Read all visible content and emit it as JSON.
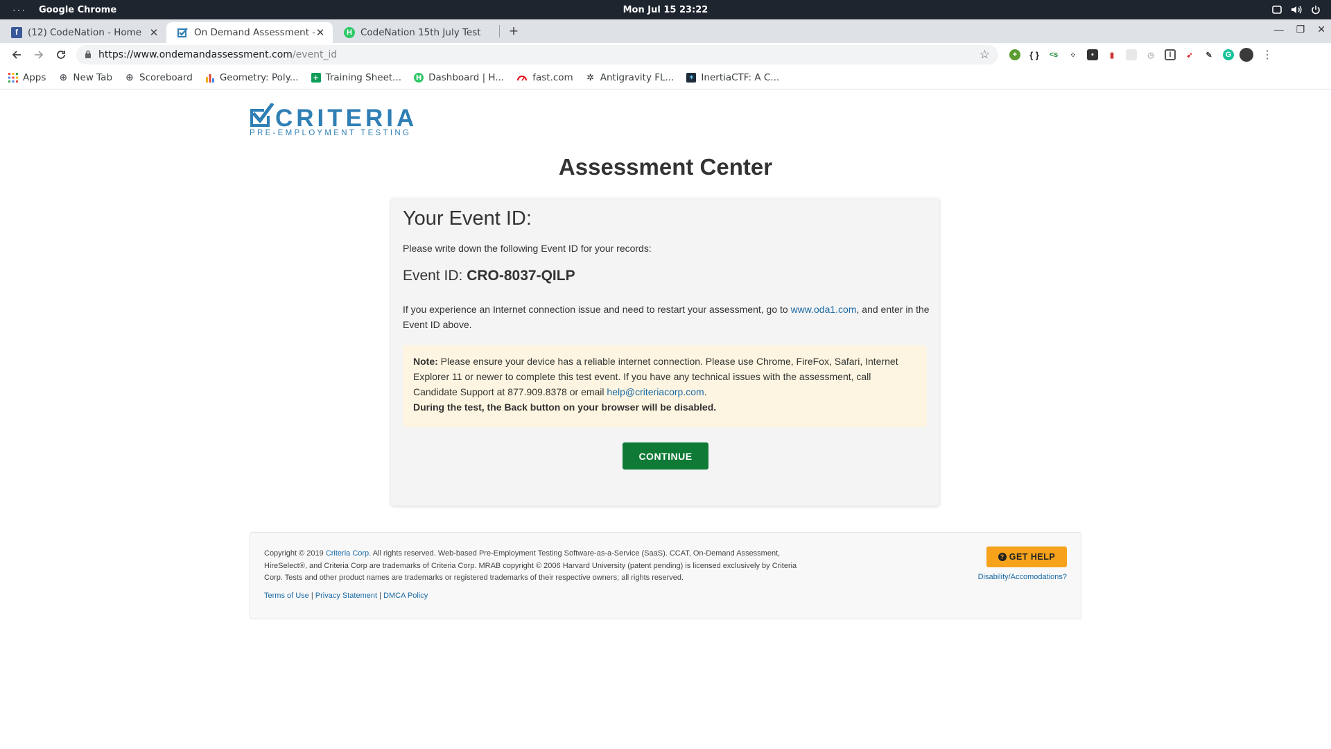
{
  "os_bar": {
    "menu": "···",
    "app_name": "Google Chrome",
    "clock": "Mon Jul 15  23:22"
  },
  "tabs": [
    {
      "title": "(12) CodeNation - Home",
      "favicon_color": "#3b5998",
      "favicon_letter": "f"
    },
    {
      "title": "On Demand Assessment -",
      "favicon_color": "#2f7fb5",
      "favicon_letter": "✓"
    },
    {
      "title": "CodeNation 15th July Test",
      "favicon_color": "#2ec866",
      "favicon_letter": "H"
    }
  ],
  "new_tab_symbol": "+",
  "toolbar": {
    "url_host": "https://www.ondemandassessment.com",
    "url_path": "/event_id"
  },
  "bookmarks": [
    {
      "label": "Apps",
      "icon": "apps-grid-icon"
    },
    {
      "label": "New Tab",
      "icon": "globe-icon"
    },
    {
      "label": "Scoreboard",
      "icon": "globe-icon"
    },
    {
      "label": "Geometry: Poly...",
      "icon": "bar-chart-icon"
    },
    {
      "label": "Training Sheet...",
      "icon": "sheets-icon"
    },
    {
      "label": "Dashboard | H...",
      "icon": "hackerrank-icon"
    },
    {
      "label": "fast.com",
      "icon": "speedometer-icon"
    },
    {
      "label": "Antigravity FL...",
      "icon": "gear-icon"
    },
    {
      "label": "InertiaCTF: A C...",
      "icon": "ctf-icon"
    }
  ],
  "logo": {
    "word": "CRITERIA",
    "tagline": "PRE-EMPLOYMENT TESTING"
  },
  "page_title": "Assessment Center",
  "card": {
    "heading": "Your Event ID:",
    "instruction": "Please write down the following Event ID for your records:",
    "event_label": "Event ID: ",
    "event_id": "CRO-8037-QILP",
    "restart_prefix": "If you experience an Internet connection issue and need to restart your assessment, go to ",
    "restart_link": "www.oda1.com",
    "restart_suffix": ", and enter in the Event ID above.",
    "note_label": "Note:",
    "note_text": " Please ensure your device has a reliable internet connection. Please use Chrome, FireFox, Safari, Internet Explorer 11 or newer to complete this test event. If you have any technical issues with the assessment, call Candidate Support at 877.909.8378 or email ",
    "note_email": "help@criteriacorp.com",
    "note_after_email": ".",
    "note_bold": "During the test, the Back button on your browser will be disabled.",
    "continue_label": "CONTINUE"
  },
  "footer": {
    "copy_prefix": "Copyright © 2019 ",
    "copy_link": "Criteria Corp",
    "copy_suffix": ". All rights reserved. Web-based Pre-Employment Testing Software-as-a-Service (SaaS). CCAT, On-Demand Assessment, HireSelect®, and Criteria Corp are trademarks of Criteria Corp. MRAB copyright © 2006 Harvard University (patent pending) is licensed exclusively by Criteria Corp. Tests and other product names are trademarks or registered trademarks of their respective owners; all rights reserved.",
    "links": [
      "Terms of Use",
      "Privacy Statement",
      "DMCA Policy"
    ],
    "link_separator": " | ",
    "get_help_label": "GET HELP",
    "disability_link": "Disability/Accomodations?"
  },
  "colors": {
    "brand_blue": "#2f7fb5",
    "continue_green": "#0f7a36",
    "get_help_orange": "#f7a21b",
    "note_bg": "#fdf5e1",
    "link_blue": "#1a6aa5"
  }
}
